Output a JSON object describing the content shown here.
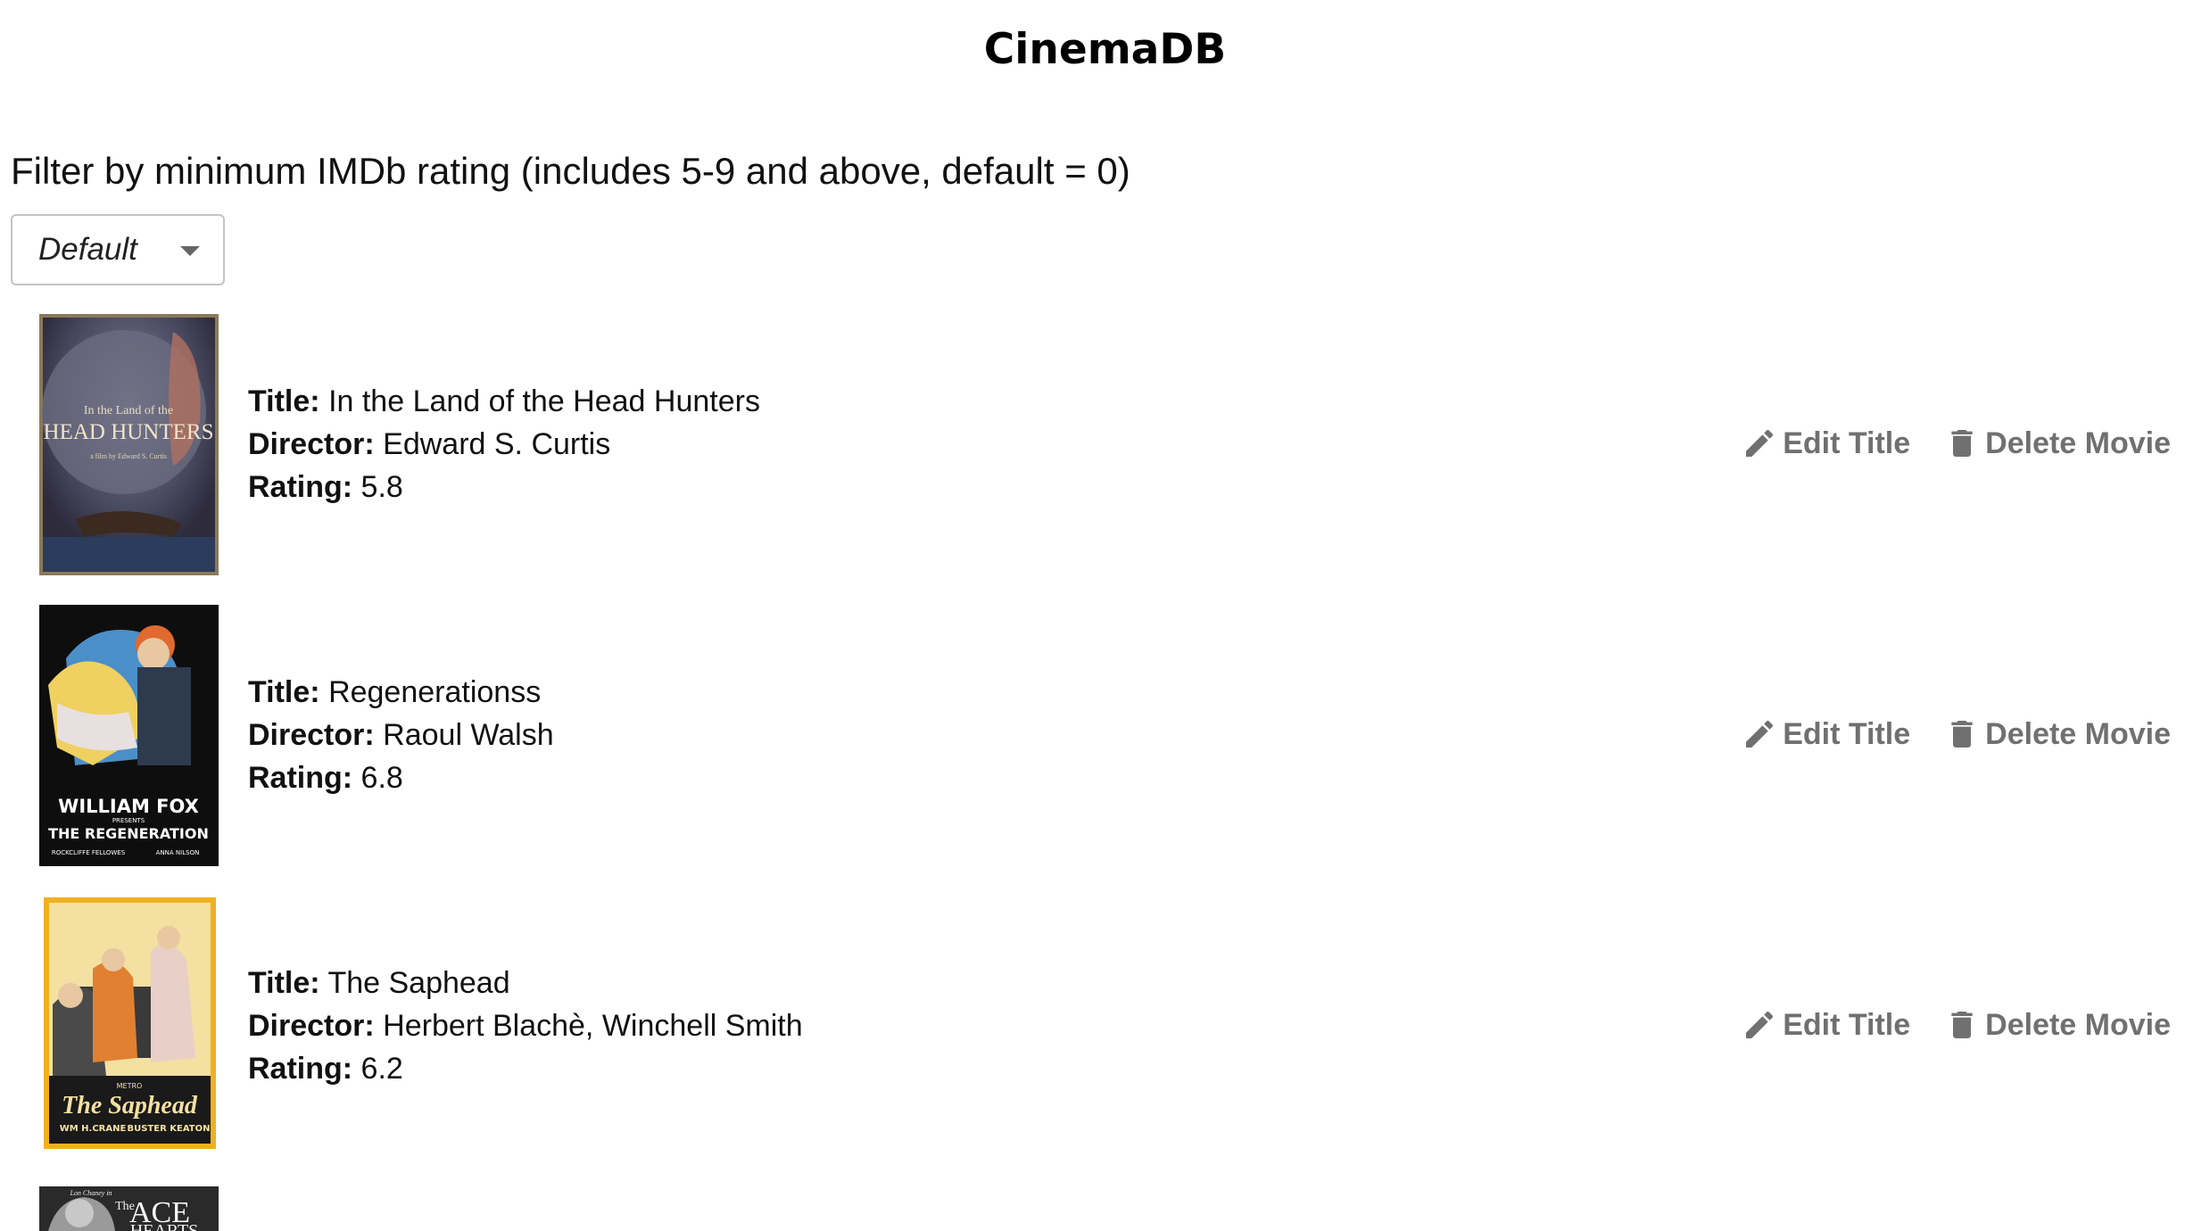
{
  "app": {
    "title": "CinemaDB"
  },
  "filter": {
    "label": "Filter by minimum IMDb rating (includes 5-9 and above, default = 0)",
    "selected": "Default"
  },
  "labels": {
    "title": "Title:",
    "director": "Director:",
    "rating": "Rating:"
  },
  "actions": {
    "edit": "Edit Title",
    "delete": "Delete Movie"
  },
  "movies": [
    {
      "title": "In the Land of the Head Hunters",
      "director": "Edward S. Curtis",
      "rating": "5.8",
      "poster_text": [
        "In the Land of the",
        "HEAD HUNTERS",
        "a film by Edward S. Curtis"
      ]
    },
    {
      "title": "Regenerationss",
      "director": "Raoul Walsh",
      "rating": "6.8",
      "poster_text": [
        "WILLIAM FOX",
        "PRESENTS",
        "THE REGENERATION",
        "ROCKCLIFFE FELLOWES",
        "ANNA NILSON"
      ]
    },
    {
      "title": "The Saphead",
      "director": "Herbert Blachè, Winchell Smith",
      "rating": "6.2",
      "poster_text": [
        "METRO",
        "The Saphead",
        "WM H.CRANE",
        "BUSTER KEATON"
      ]
    },
    {
      "poster_text": [
        "Lon Chaney in",
        "The",
        "ACE",
        "HEARTS"
      ]
    }
  ],
  "colors": {
    "action_gray": "#707070",
    "border": "#c4c4c4"
  },
  "icons": {
    "edit": "pencil-icon",
    "delete": "trash-icon",
    "select": "caret-down-icon"
  }
}
